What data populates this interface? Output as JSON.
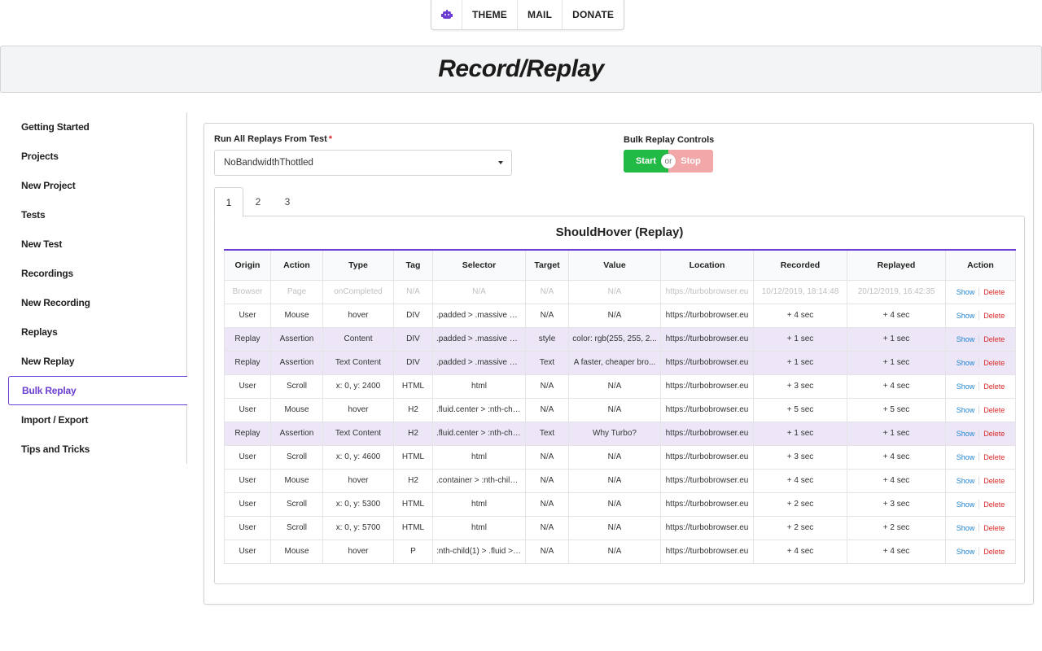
{
  "topnav": {
    "theme": "THEME",
    "mail": "MAIL",
    "donate": "DONATE"
  },
  "header": {
    "title": "Record/Replay"
  },
  "sidebar": {
    "items": [
      {
        "label": "Getting Started"
      },
      {
        "label": "Projects"
      },
      {
        "label": "New Project"
      },
      {
        "label": "Tests"
      },
      {
        "label": "New Test"
      },
      {
        "label": "Recordings"
      },
      {
        "label": "New Recording"
      },
      {
        "label": "Replays"
      },
      {
        "label": "New Replay"
      },
      {
        "label": "Bulk Replay",
        "active": true
      },
      {
        "label": "Import / Export"
      },
      {
        "label": "Tips and Tricks"
      }
    ]
  },
  "form": {
    "run_label": "Run All Replays From Test",
    "required_mark": "*",
    "selected_test": "NoBandwidthThottled",
    "bulk_label": "Bulk Replay Controls",
    "start": "Start",
    "or": "or",
    "stop": "Stop"
  },
  "tabs": [
    "1",
    "2",
    "3"
  ],
  "table": {
    "title": "ShouldHover (Replay)",
    "columns": [
      "Origin",
      "Action",
      "Type",
      "Tag",
      "Selector",
      "Target",
      "Value",
      "Location",
      "Recorded",
      "Replayed",
      "Action"
    ],
    "show_label": "Show",
    "delete_label": "Delete",
    "rows": [
      {
        "style": "dim",
        "cells": [
          "Browser",
          "Page",
          "onCompleted",
          "N/A",
          "N/A",
          "N/A",
          "N/A",
          "https://turbobrowser.eu",
          "10/12/2019, 18:14:48",
          "20/12/2019, 16:42:35"
        ]
      },
      {
        "style": "",
        "cells": [
          "User",
          "Mouse",
          "hover",
          "DIV",
          ".padded > .massive > ...",
          "N/A",
          "N/A",
          "https://turbobrowser.eu",
          "+ 4 sec",
          "+ 4 sec"
        ]
      },
      {
        "style": "replay",
        "cells": [
          "Replay",
          "Assertion",
          "Content",
          "DIV",
          ".padded > .massive > ...",
          "style",
          "color: rgb(255, 255, 2...",
          "https://turbobrowser.eu",
          "+ 1 sec",
          "+ 1 sec"
        ]
      },
      {
        "style": "replay",
        "cells": [
          "Replay",
          "Assertion",
          "Text Content",
          "DIV",
          ".padded > .massive > ...",
          "Text",
          "A faster, cheaper bro...",
          "https://turbobrowser.eu",
          "+ 1 sec",
          "+ 1 sec"
        ]
      },
      {
        "style": "",
        "cells": [
          "User",
          "Scroll",
          "x: 0, y: 2400",
          "HTML",
          "html",
          "N/A",
          "N/A",
          "https://turbobrowser.eu",
          "+ 3 sec",
          "+ 4 sec"
        ]
      },
      {
        "style": "",
        "cells": [
          "User",
          "Mouse",
          "hover",
          "H2",
          ".fluid.center > :nth-chil...",
          "N/A",
          "N/A",
          "https://turbobrowser.eu",
          "+ 5 sec",
          "+ 5 sec"
        ]
      },
      {
        "style": "replay",
        "cells": [
          "Replay",
          "Assertion",
          "Text Content",
          "H2",
          ".fluid.center > :nth-chil...",
          "Text",
          "Why Turbo?",
          "https://turbobrowser.eu",
          "+ 1 sec",
          "+ 1 sec"
        ]
      },
      {
        "style": "",
        "cells": [
          "User",
          "Scroll",
          "x: 0, y: 4600",
          "HTML",
          "html",
          "N/A",
          "N/A",
          "https://turbobrowser.eu",
          "+ 3 sec",
          "+ 4 sec"
        ]
      },
      {
        "style": "",
        "cells": [
          "User",
          "Mouse",
          "hover",
          "H2",
          ".container > :nth-child(...",
          "N/A",
          "N/A",
          "https://turbobrowser.eu",
          "+ 4 sec",
          "+ 4 sec"
        ]
      },
      {
        "style": "",
        "cells": [
          "User",
          "Scroll",
          "x: 0, y: 5300",
          "HTML",
          "html",
          "N/A",
          "N/A",
          "https://turbobrowser.eu",
          "+ 2 sec",
          "+ 3 sec"
        ]
      },
      {
        "style": "",
        "cells": [
          "User",
          "Scroll",
          "x: 0, y: 5700",
          "HTML",
          "html",
          "N/A",
          "N/A",
          "https://turbobrowser.eu",
          "+ 2 sec",
          "+ 2 sec"
        ]
      },
      {
        "style": "",
        "cells": [
          "User",
          "Mouse",
          "hover",
          "P",
          ":nth-child(1) > .fluid > .f...",
          "N/A",
          "N/A",
          "https://turbobrowser.eu",
          "+ 4 sec",
          "+ 4 sec"
        ]
      }
    ]
  }
}
